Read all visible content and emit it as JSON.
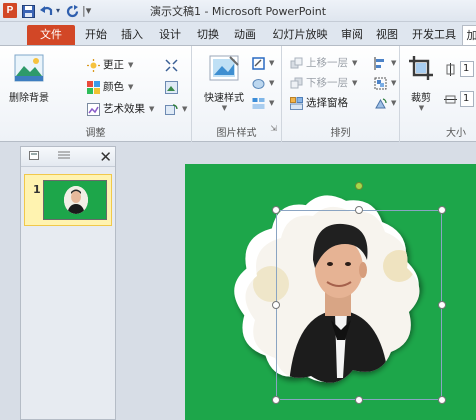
{
  "titlebar": {
    "app_logo": "P",
    "title": "演示文稿1 - Microsoft PowerPoint"
  },
  "tabs": [
    "文件",
    "开始",
    "插入",
    "设计",
    "切换",
    "动画",
    "幻灯片放映",
    "审阅",
    "视图",
    "开发工具",
    "加"
  ],
  "ribbon": {
    "adjust": {
      "remove_bg": "删除背景",
      "corrections": "更正",
      "color": "颜色",
      "artistic": "艺术效果",
      "label": "调整"
    },
    "styles": {
      "quick_styles": "快速样式",
      "label": "图片样式"
    },
    "arrange": {
      "bring_forward": "上移一层",
      "send_backward": "下移一层",
      "selection_pane": "选择窗格",
      "label": "排列"
    },
    "size": {
      "crop": "裁剪",
      "label": "大小",
      "height_partial": "1",
      "width_partial": "1"
    }
  },
  "left_panel": {
    "slide_number": "1"
  },
  "colors": {
    "slide_bg": "#1da64a",
    "file_tab": "#d24726"
  }
}
